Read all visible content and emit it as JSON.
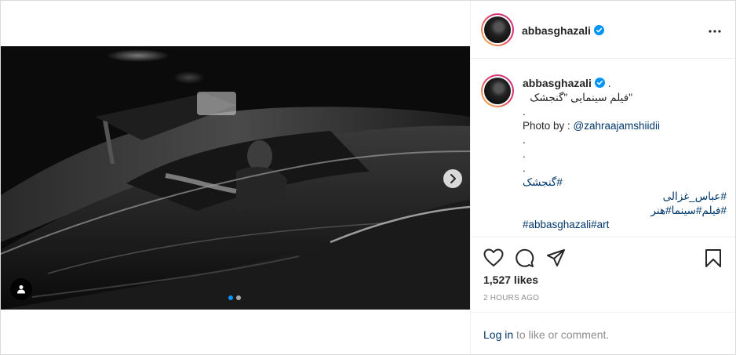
{
  "post": {
    "username": "abbasghazali",
    "verified": true,
    "caption_dot": ".",
    "caption_lines": [
      "\"فیلم سینمایی \"گنجشک",
      ".",
      "Photo by : @zahraajamshiidii",
      ".",
      ".",
      "."
    ],
    "hashtags": [
      "#گنجشک",
      "#عباس_غزالی",
      "#فیلم#سینما#هنر",
      "#abbasghazali#art"
    ],
    "likes": "1,527 likes",
    "time": "2 HOURS AGO",
    "login_link": "Log in",
    "login_rest": " to like or comment.",
    "carousel": {
      "slides": 2,
      "current": 1
    }
  },
  "icons": {
    "more": "more-options-icon",
    "like": "heart-icon",
    "comment": "comment-icon",
    "share": "share-icon",
    "save": "bookmark-icon",
    "next": "chevron-right-icon",
    "tag": "user-tag-icon",
    "verified": "verified-badge-icon"
  },
  "colors": {
    "link": "#00376b",
    "verified": "#0095f6",
    "muted": "#8e8e8e",
    "text": "#262626"
  }
}
